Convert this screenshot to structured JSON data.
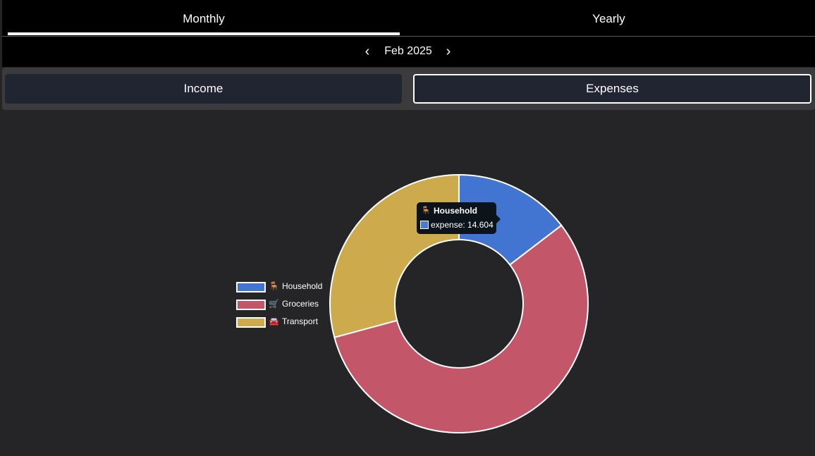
{
  "tabs": {
    "monthly": "Monthly",
    "yearly": "Yearly",
    "active": "Monthly"
  },
  "date_nav": {
    "prev_icon": "chevron-left-icon",
    "prev_glyph": "‹",
    "label": "Feb 2025",
    "next_icon": "chevron-right-icon",
    "next_glyph": "›"
  },
  "segment": {
    "income": "Income",
    "expenses": "Expenses",
    "active": "Expenses"
  },
  "legend": [
    {
      "emoji": "🪑",
      "label": "Household",
      "color": "#4274d1"
    },
    {
      "emoji": "🛒",
      "label": "Groceries",
      "color": "#c4566a"
    },
    {
      "emoji": "🚘",
      "label": "Transport",
      "color": "#cdab4c"
    }
  ],
  "tooltip": {
    "emoji": "🪑",
    "title": "Household",
    "text": "expense: 14.604"
  },
  "chart_data": {
    "type": "pie",
    "variant": "doughnut",
    "categories": [
      "Household",
      "Groceries",
      "Transport"
    ],
    "values": [
      14.604,
      56.2,
      29.2
    ],
    "colors": [
      "#4274d1",
      "#c4566a",
      "#cdab4c"
    ],
    "legend_position": "left"
  }
}
